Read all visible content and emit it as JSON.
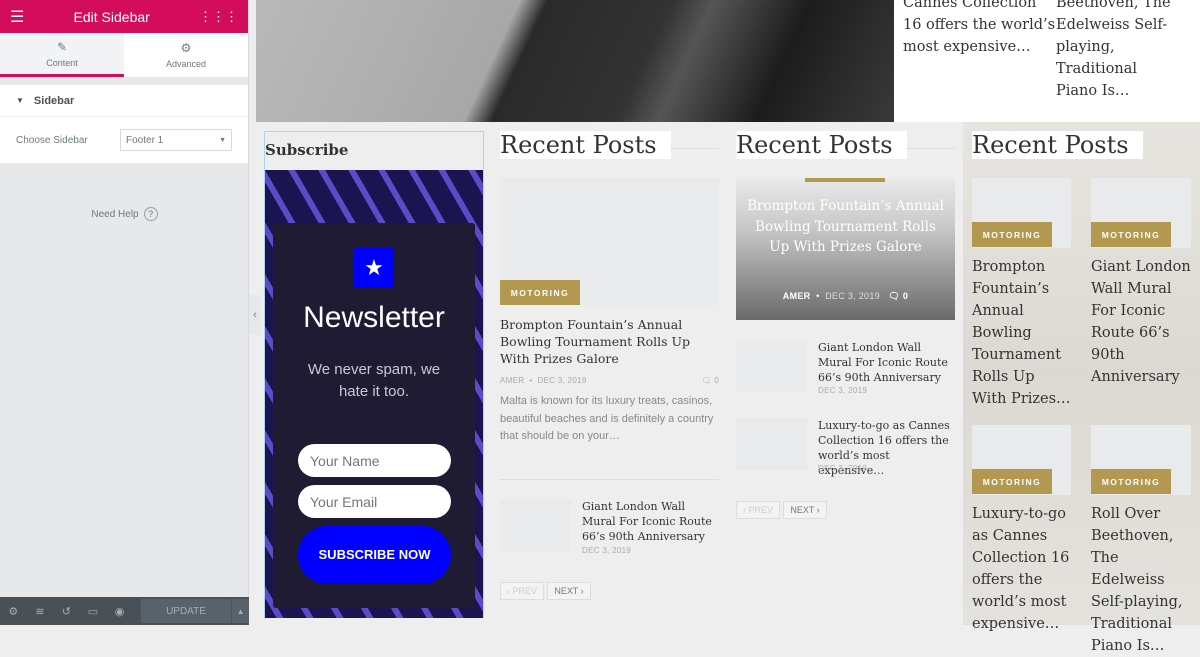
{
  "editor": {
    "header": {
      "title": "Edit Sidebar",
      "menu_icon": "hamburger-icon",
      "apps_icon": "grid-icon"
    },
    "tabs": [
      {
        "label": "Content",
        "icon": "pencil-icon",
        "active": true
      },
      {
        "label": "Advanced",
        "icon": "gear-icon",
        "active": false
      }
    ],
    "section": {
      "label": "Sidebar"
    },
    "field": {
      "label": "Choose Sidebar",
      "value": "Footer 1"
    },
    "help": "Need Help",
    "footer": {
      "update_label": "UPDATE"
    },
    "accent": "#d30c5c"
  },
  "top_posts": [
    {
      "lines": [
        "Cannes Collection",
        "16 offers the world’s",
        "most expensive…"
      ]
    },
    {
      "lines": [
        "Beethoven, The",
        "Edelweiss Self-",
        "playing, Traditional",
        "Piano Is…"
      ]
    }
  ],
  "subscribe": {
    "heading": "Subscribe",
    "title": "Newsletter",
    "tagline": "We never spam, we hate it too.",
    "name_placeholder": "Your Name",
    "email_placeholder": "Your Email",
    "button": "SUBSCRIBE NOW",
    "button_color": "#0000ff"
  },
  "col1": {
    "heading": "Recent Posts",
    "featured": {
      "category": "MOTORING",
      "title": "Brompton Fountain’s Annual Bowling Tournament Rolls Up With Prizes Galore",
      "author": "AMER",
      "date": "DEC 3, 2019",
      "comments": "0",
      "excerpt": "Malta is known for its luxury treats, casinos, beautiful beaches and is definitely a country that should be on your…"
    },
    "items": [
      {
        "title": "Giant London Wall Mural For Iconic Route 66’s 90th Anniversary",
        "date": "DEC 3, 2019"
      }
    ],
    "prev": "‹ PREV",
    "next": "NEXT ›"
  },
  "col2": {
    "heading": "Recent Posts",
    "featured": {
      "title": "Brompton Fountain’s Annual Bowling Tournament Rolls Up With Prizes Galore",
      "author": "AMER",
      "date": "DEC 3, 2019",
      "comments": "0"
    },
    "items": [
      {
        "title": "Giant London Wall Mural For Iconic Route 66’s 90th Anniversary",
        "date": "DEC 3, 2019"
      },
      {
        "title": "Luxury-to-go as Cannes Collection 16 offers the world’s most expensive…",
        "date": "DEC 3, 2019"
      }
    ],
    "prev": "‹ PREV",
    "next": "NEXT ›"
  },
  "col3": {
    "heading": "Recent Posts",
    "items": [
      {
        "category": "MOTORING",
        "title": "Brompton Fountain’s Annual Bowling Tournament Rolls Up With Prizes…"
      },
      {
        "category": "MOTORING",
        "title": "Giant London Wall Mural For Iconic Route 66’s 90th Anniversary"
      },
      {
        "category": "MOTORING",
        "title": "Luxury-to-go as Cannes Collection 16 offers the world’s most expensive…"
      },
      {
        "category": "MOTORING",
        "title": "Roll Over Beethoven, The Edelweiss Self-playing, Traditional Piano Is…"
      }
    ]
  },
  "category_color": "#b3984f"
}
